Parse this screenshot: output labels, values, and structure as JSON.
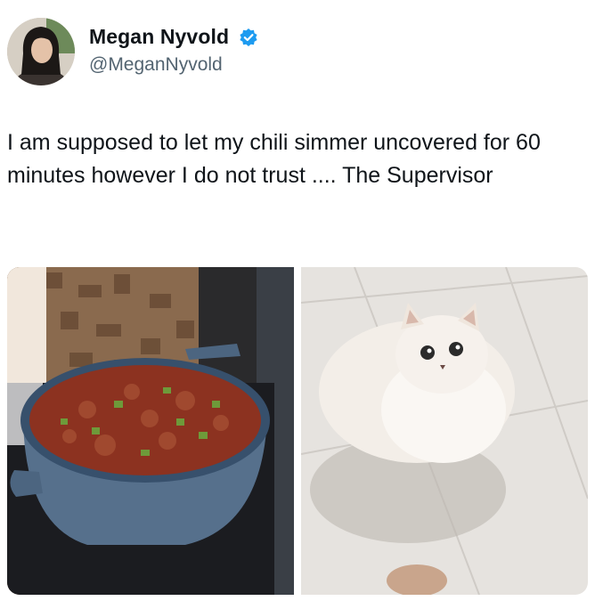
{
  "author": {
    "display_name": "Megan Nyvold",
    "handle": "@MeganNyvold",
    "verified": true,
    "verified_icon": "verified-badge-icon",
    "accent_color": "#1d9bf0"
  },
  "tweet": {
    "text": "I am supposed to let my chili simmer uncovered for 60 minutes however I do not trust .... The Supervisor"
  },
  "media": {
    "photo_count": 2,
    "photos": [
      {
        "subject": "chili-pot-photo"
      },
      {
        "subject": "white-cat-photo"
      }
    ]
  }
}
